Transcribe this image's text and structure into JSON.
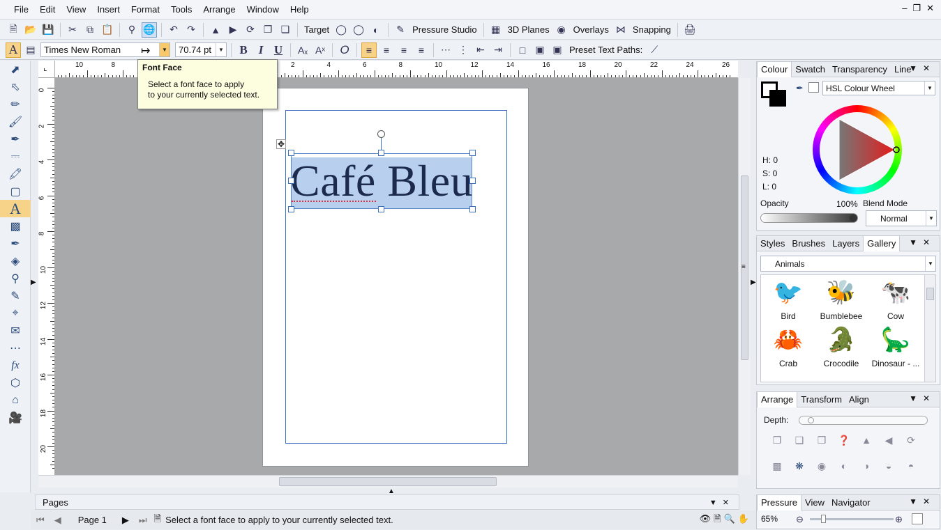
{
  "menu": [
    "File",
    "Edit",
    "View",
    "Insert",
    "Format",
    "Tools",
    "Arrange",
    "Window",
    "Help"
  ],
  "window_controls": [
    "‒",
    "❐",
    "✕"
  ],
  "toolbar1": {
    "target_label": "Target",
    "pressure_label": "Pressure Studio",
    "planes_label": "3D Planes",
    "overlays_label": "Overlays",
    "snapping_label": "Snapping"
  },
  "toolbar2": {
    "font_face": "Times New Roman",
    "font_size": "70.74 pt",
    "bold": "B",
    "italic": "I",
    "underline": "U",
    "preset_label": "Preset Text Paths:"
  },
  "tooltip": {
    "title": "Font Face",
    "line1": "Select a font face to apply",
    "line2": "to your currently selected text."
  },
  "ruler_top": [
    "10",
    "8",
    "6",
    "4",
    "2",
    "0",
    "2",
    "4",
    "6",
    "8",
    "10",
    "12",
    "14",
    "16",
    "18",
    "20",
    "22",
    "24",
    "26"
  ],
  "ruler_left": [
    "0",
    "2",
    "4",
    "6",
    "8",
    "10",
    "12",
    "14",
    "16",
    "18",
    "20"
  ],
  "document": {
    "text": "Café Bleu"
  },
  "pages_panel": {
    "label": "Pages"
  },
  "status": {
    "page_label": "Page 1",
    "message": "Select a font face to apply to your currently selected text.",
    "zoom": "65%"
  },
  "colour_panel": {
    "tabs": [
      "Colour",
      "Swatch",
      "Transparency",
      "Line"
    ],
    "mode": "HSL Colour Wheel",
    "h": "H: 0",
    "s": "S: 0",
    "l": "L: 0",
    "opacity_label": "Opacity",
    "opacity_value": "100%",
    "blend_label": "Blend Mode",
    "blend_value": "Normal"
  },
  "gallery_panel": {
    "tabs": [
      "Styles",
      "Brushes",
      "Layers",
      "Gallery"
    ],
    "category": "Animals",
    "items": [
      {
        "label": "Bird",
        "glyph": "🐦"
      },
      {
        "label": "Bumblebee",
        "glyph": "🐝"
      },
      {
        "label": "Cow",
        "glyph": "🐄"
      },
      {
        "label": "Crab",
        "glyph": "🦀"
      },
      {
        "label": "Crocodile",
        "glyph": "🐊"
      },
      {
        "label": "Dinosaur - ...",
        "glyph": "🦕"
      }
    ]
  },
  "arrange_panel": {
    "tabs": [
      "Arrange",
      "Transform",
      "Align"
    ],
    "depth_label": "Depth:"
  },
  "bottom_right_panel": {
    "tabs": [
      "Pressure",
      "View",
      "Navigator"
    ]
  }
}
